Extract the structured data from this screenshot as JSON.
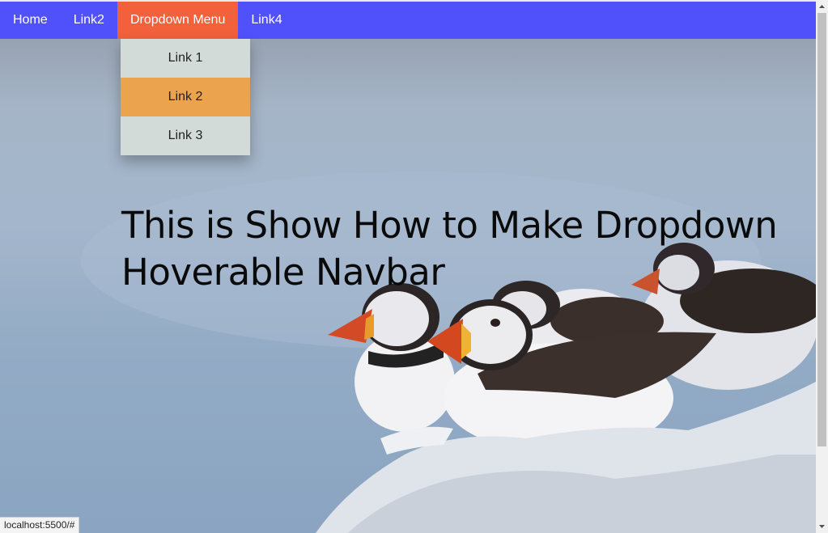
{
  "navbar": {
    "items": [
      {
        "label": "Home"
      },
      {
        "label": "Link2"
      },
      {
        "label": "Dropdown Menu"
      },
      {
        "label": "Link4"
      }
    ],
    "active_color": "#f2603c",
    "background": "#5151fc"
  },
  "dropdown": {
    "items": [
      {
        "label": "Link 1"
      },
      {
        "label": "Link 2"
      },
      {
        "label": "Link 3"
      }
    ],
    "hover_color": "#eba34d",
    "background": "#d3dbd9"
  },
  "headline": {
    "text": "This is Show How to Make Dropdown Hoverable Navbar"
  },
  "status_bar": {
    "url": "localhost:5500/#"
  },
  "background_image": {
    "icon": "puffins-on-rock-photo"
  }
}
